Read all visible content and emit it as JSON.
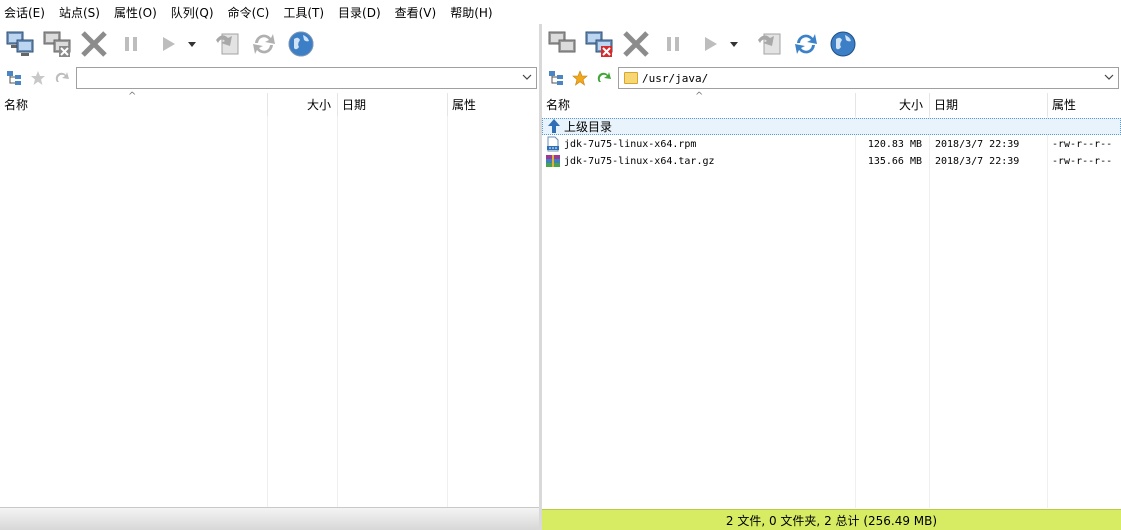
{
  "menu": [
    "会话(E)",
    "站点(S)",
    "属性(O)",
    "队列(Q)",
    "命令(C)",
    "工具(T)",
    "目录(D)",
    "查看(V)",
    "帮助(H)"
  ],
  "left_pane": {
    "address": "",
    "columns": {
      "name": "名称",
      "size": "大小",
      "date": "日期",
      "attr": "属性"
    }
  },
  "right_pane": {
    "address": "/usr/java/",
    "columns": {
      "name": "名称",
      "size": "大小",
      "date": "日期",
      "attr": "属性"
    },
    "parent_dir_label": "上级目录",
    "files": [
      {
        "name": "jdk-7u75-linux-x64.rpm",
        "size": "120.83 MB",
        "date": "2018/3/7 22:39",
        "attr": "-rw-r--r--",
        "icon": "rpm-file-icon"
      },
      {
        "name": "jdk-7u75-linux-x64.tar.gz",
        "size": "135.66 MB",
        "date": "2018/3/7 22:39",
        "attr": "-rw-r--r--",
        "icon": "archive-file-icon"
      }
    ]
  },
  "status_text": "2 文件, 0 文件夹, 2 总计 (256.49 MB)",
  "colors": {
    "status_bg": "#d7ec63",
    "selection_border": "#5a9ad8"
  }
}
